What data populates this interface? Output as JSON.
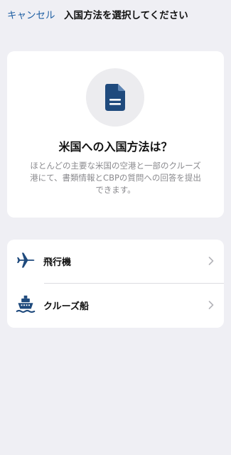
{
  "header": {
    "cancel_label": "キャンセル",
    "title": "入国方法を選択してください"
  },
  "info_card": {
    "icon": "document-icon",
    "heading": "米国への入国方法は？",
    "description": "ほとんどの主要な米国の空港と一部のクルーズ港にて、書類情報とCBPの質問への回答を提出できます。"
  },
  "options": [
    {
      "label": "飛行機",
      "icon": "airplane-icon"
    },
    {
      "label": "クルーズ船",
      "icon": "ship-icon"
    }
  ],
  "colors": {
    "accent": "#1f5fa3",
    "icon_navy": "#1f4a7d",
    "background": "#efeff4",
    "card": "#ffffff",
    "secondary_text": "#8a8a8e"
  }
}
